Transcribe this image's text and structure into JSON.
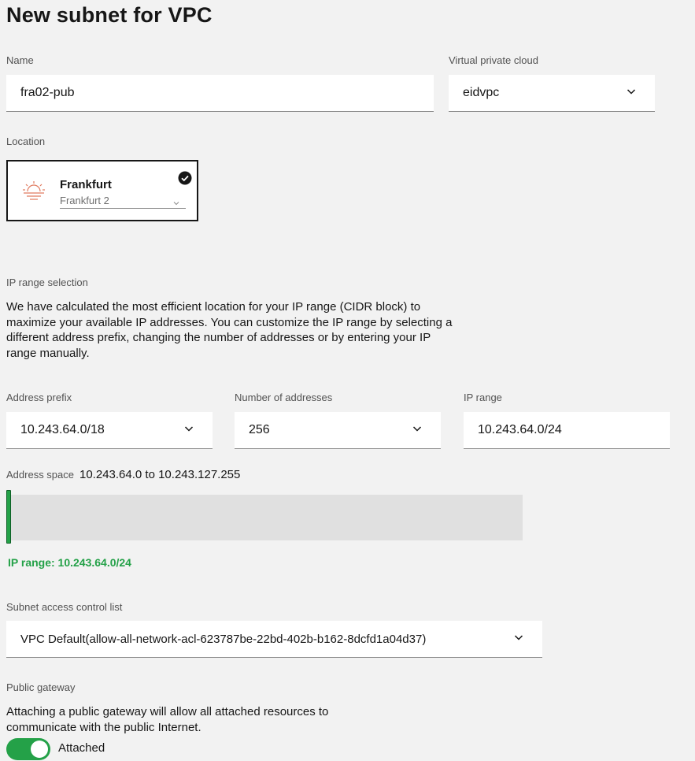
{
  "page": {
    "title": "New subnet for VPC"
  },
  "name_field": {
    "label": "Name",
    "value": "fra02-pub"
  },
  "vpc_field": {
    "label": "Virtual private cloud",
    "value": "eidvpc"
  },
  "location": {
    "label": "Location",
    "tile": {
      "city": "Frankfurt",
      "zone": "Frankfurt 2",
      "selected": true,
      "icon": "sun-horizon-icon"
    }
  },
  "ip_range_selection": {
    "label": "IP range selection",
    "description": [
      "We have calculated the most efficient location for your IP range (CIDR block) to",
      "maximize your available IP addresses. You can customize the IP range by selecting a",
      "different address prefix, changing the number of addresses or by entering your IP",
      "range manually."
    ]
  },
  "address_prefix": {
    "label": "Address prefix",
    "value": "10.243.64.0/18"
  },
  "number_of_addresses": {
    "label": "Number of addresses",
    "value": "256"
  },
  "ip_range": {
    "label": "IP range",
    "value": "10.243.64.0/24"
  },
  "address_space": {
    "label": "Address space",
    "value": "10.243.64.0 to 10.243.127.255",
    "selected_text": "IP range: 10.243.64.0/24",
    "selected_fraction": 0.0039
  },
  "acl": {
    "label": "Subnet access control list",
    "value": "VPC Default(allow-all-network-acl-623787be-22bd-402b-b162-8dcfd1a04d37)"
  },
  "public_gateway": {
    "label": "Public gateway",
    "description": [
      "Attaching a public gateway will allow all attached resources to",
      "communicate with the public Internet."
    ],
    "toggle_on": true,
    "toggle_label": "Attached"
  },
  "colors": {
    "accent_green": "#24a148",
    "field_bg": "#ffffff",
    "page_bg": "#f2f2f2"
  }
}
